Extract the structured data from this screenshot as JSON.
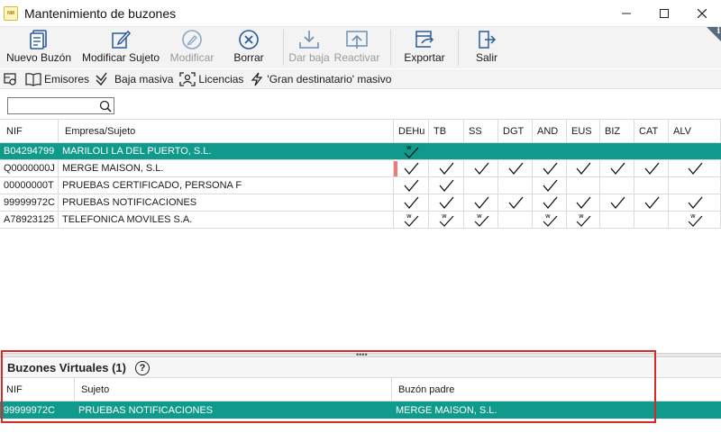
{
  "window": {
    "title": "Mantenimiento de buzones",
    "app_icon_text": "NM",
    "controls": [
      "minimize-icon",
      "maximize-icon",
      "close-icon"
    ]
  },
  "toolbar": {
    "buttons": [
      {
        "label": "Nuevo Buzón",
        "icon": "mailbox-new-icon",
        "enabled": true
      },
      {
        "label": "Modificar Sujeto",
        "icon": "edit-icon",
        "enabled": true
      },
      {
        "label": "Modificar",
        "icon": "pencil-circle-icon",
        "enabled": false
      },
      {
        "label": "Borrar",
        "icon": "delete-icon",
        "enabled": true
      },
      {
        "label": "Dar baja",
        "icon": "download-tray-icon",
        "enabled": false
      },
      {
        "label": "Reactivar",
        "icon": "upload-tray-icon",
        "enabled": false
      },
      {
        "label": "Exportar",
        "icon": "export-icon",
        "enabled": true
      },
      {
        "label": "Salir",
        "icon": "exit-door-icon",
        "enabled": true
      }
    ],
    "info_label": "i"
  },
  "toolbar2": {
    "buttons": [
      {
        "label": "",
        "icon": "settings-key-icon"
      },
      {
        "label": "Emisores",
        "icon": "book-icon"
      },
      {
        "label": "Baja masiva",
        "icon": "double-check-icon"
      },
      {
        "label": "Licencias",
        "icon": "scan-person-icon"
      },
      {
        "label": "'Gran destinatario' masivo",
        "icon": "lightning-icon"
      }
    ]
  },
  "search": {
    "value": "",
    "placeholder": ""
  },
  "grid": {
    "columns": [
      "NIF",
      "Empresa/Sujeto",
      "DEHu",
      "TB",
      "SS",
      "DGT",
      "AND",
      "EUS",
      "BIZ",
      "CAT",
      "ALV"
    ],
    "rows": [
      {
        "nif": "B04294799",
        "empresa": "MARILOLI LA DEL PUERTO, S.L.",
        "selected": true,
        "flag": false,
        "cells": [
          "w",
          "",
          "",
          "",
          "",
          "",
          "",
          "",
          ""
        ]
      },
      {
        "nif": "Q0000000J",
        "empresa": "MERGE MAISON, S.L.",
        "selected": false,
        "flag": true,
        "cells": [
          "c",
          "c",
          "c",
          "c",
          "c",
          "c",
          "c",
          "c",
          "c"
        ]
      },
      {
        "nif": "00000000T",
        "empresa": "PRUEBAS CERTIFICADO, PERSONA F",
        "selected": false,
        "flag": false,
        "cells": [
          "c",
          "c",
          "",
          "",
          "c",
          "",
          "",
          "",
          ""
        ]
      },
      {
        "nif": "99999972C",
        "empresa": "PRUEBAS NOTIFICACIONES",
        "selected": false,
        "flag": false,
        "cells": [
          "c",
          "c",
          "c",
          "c",
          "c",
          "c",
          "c",
          "c",
          "c"
        ]
      },
      {
        "nif": "A78923125",
        "empresa": "TELEFONICA MOVILES  S.A.",
        "selected": false,
        "flag": false,
        "cells": [
          "w",
          "w",
          "w",
          "",
          "w",
          "w",
          "",
          "",
          "w"
        ]
      }
    ]
  },
  "virtual_panel": {
    "title": "Buzones Virtuales (1)",
    "help_label": "?",
    "columns": [
      "NIF",
      "Sujeto",
      "Buzón padre"
    ],
    "rows": [
      {
        "nif": "99999972C",
        "sujeto": "PRUEBAS NOTIFICACIONES",
        "padre": "MERGE MAISON, S.L."
      }
    ]
  },
  "colors": {
    "accent": "#0f9a8c",
    "highlight_border": "#d42a2a",
    "flag": "#f07a7a"
  }
}
